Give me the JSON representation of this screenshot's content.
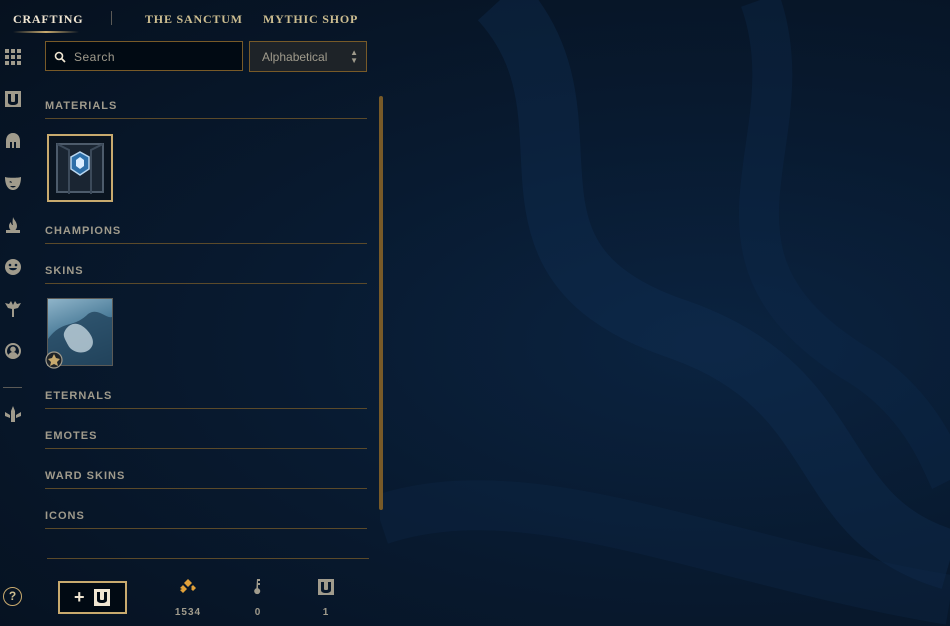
{
  "nav": {
    "tabs": [
      {
        "label": "CRAFTING",
        "active": true
      },
      {
        "label": "THE SANCTUM",
        "active": false
      },
      {
        "label": "MYTHIC SHOP",
        "active": false
      }
    ]
  },
  "rail": {
    "icons": [
      "grid-icon",
      "chest-icon",
      "helmet-icon",
      "mask-icon",
      "ward-icon",
      "emote-icon",
      "eternal-icon",
      "profile-icon",
      "loot-icon"
    ]
  },
  "search": {
    "placeholder": "Search",
    "value": ""
  },
  "sort": {
    "selected": "Alphabetical"
  },
  "categories": {
    "materials": "MATERIALS",
    "champions": "CHAMPIONS",
    "skins": "SKINS",
    "eternals": "ETERNALS",
    "emotes": "EMOTES",
    "ward_skins": "WARD SKINS",
    "icons": "ICONS"
  },
  "help_label": "?",
  "currency": {
    "essence": {
      "icon": "orange-essence-icon",
      "count": "1534"
    },
    "keys": {
      "icon": "key-icon",
      "count": "0"
    },
    "chests": {
      "icon": "chest-icon",
      "count": "1"
    }
  },
  "colors": {
    "gold": "#c8aa6e",
    "text": "#a09b8c",
    "accent": "#f0e6d2",
    "essence": "#e1a13a"
  }
}
